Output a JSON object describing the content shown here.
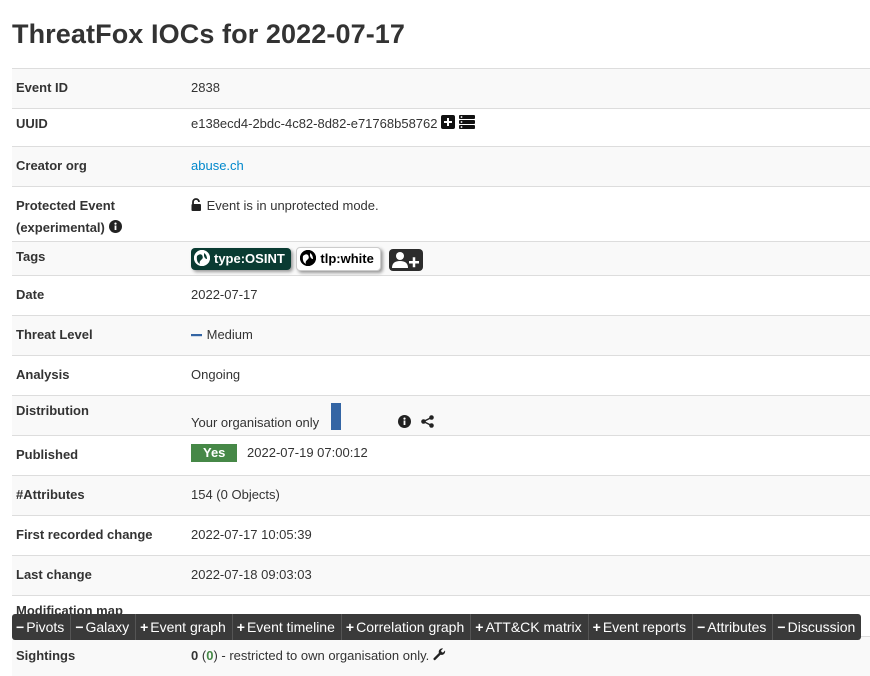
{
  "title": "ThreatFox IOCs for 2022-07-17",
  "event_id": {
    "label": "Event ID",
    "value": "2838"
  },
  "uuid": {
    "label": "UUID",
    "value": "e138ecd4-2bdc-4c82-8d82-e71768b58762"
  },
  "creator_org": {
    "label": "Creator org",
    "value": "abuse.ch"
  },
  "protected": {
    "label": "Protected Event",
    "label2": "(experimental)",
    "value": "Event is in unprotected mode."
  },
  "tags": {
    "label": "Tags",
    "items": [
      "type:OSINT",
      "tlp:white"
    ]
  },
  "date": {
    "label": "Date",
    "value": "2022-07-17"
  },
  "threat_level": {
    "label": "Threat Level",
    "value": "Medium"
  },
  "analysis": {
    "label": "Analysis",
    "value": "Ongoing"
  },
  "distribution": {
    "label": "Distribution",
    "value": "Your organisation only",
    "bar_fraction": 1.0
  },
  "published": {
    "label": "Published",
    "badge": "Yes",
    "value": "2022-07-19 07:00:12"
  },
  "attributes": {
    "label": "#Attributes",
    "value": "154 (0 Objects)"
  },
  "first_change": {
    "label": "First recorded change",
    "value": "2022-07-17 10:05:39"
  },
  "last_change": {
    "label": "Last change",
    "value": "2022-07-18 09:03:03"
  },
  "modification_map": {
    "label": "Modification map"
  },
  "sightings": {
    "label": "Sightings",
    "count": "0",
    "open": "(",
    "count2": "0",
    "close": ")",
    "text": " - restricted to own organisation only."
  },
  "tabs": [
    {
      "sym": "−",
      "label": "Pivots"
    },
    {
      "sym": "−",
      "label": "Galaxy"
    },
    {
      "sym": "+",
      "label": "Event graph"
    },
    {
      "sym": "+",
      "label": "Event timeline"
    },
    {
      "sym": "+",
      "label": "Correlation graph"
    },
    {
      "sym": "+",
      "label": "ATT&CK matrix"
    },
    {
      "sym": "+",
      "label": "Event reports"
    },
    {
      "sym": "−",
      "label": "Attributes"
    },
    {
      "sym": "−",
      "label": "Discussion"
    }
  ],
  "colors": {
    "tag_osint": "#0a3b32",
    "published_green": "#468847",
    "distribution_bar": "#3465a4",
    "link": "#0088cc"
  }
}
